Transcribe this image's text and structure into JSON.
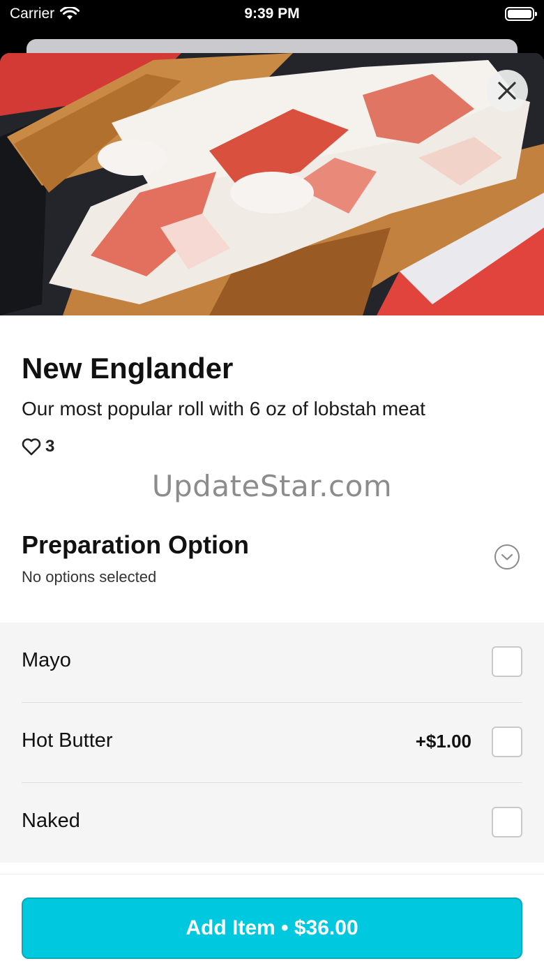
{
  "status_bar": {
    "carrier": "Carrier",
    "time": "9:39 PM",
    "icons": [
      "wifi-icon",
      "battery-icon"
    ]
  },
  "hero": {
    "image_subject": "lobster roll in red basket",
    "close_icon": "close-icon"
  },
  "item": {
    "title": "New Englander",
    "description": "Our most popular roll with 6 oz of lobstah meat",
    "likes_count": "3",
    "likes_icon": "heart-outline-icon"
  },
  "watermark": "UpdateStar.com",
  "preparation": {
    "title": "Preparation Option",
    "subtitle": "No options selected",
    "toggle_icon": "chevron-down-circle-icon",
    "options": [
      {
        "label": "Mayo",
        "price": "",
        "checked": false
      },
      {
        "label": "Hot Butter",
        "price": "+$1.00",
        "checked": false
      },
      {
        "label": "Naked",
        "price": "",
        "checked": false
      }
    ]
  },
  "footer": {
    "add_button_label": "Add Item • $36.00"
  },
  "colors": {
    "accent": "#00c8df",
    "text": "#111111",
    "options_background": "#f5f5f5"
  }
}
